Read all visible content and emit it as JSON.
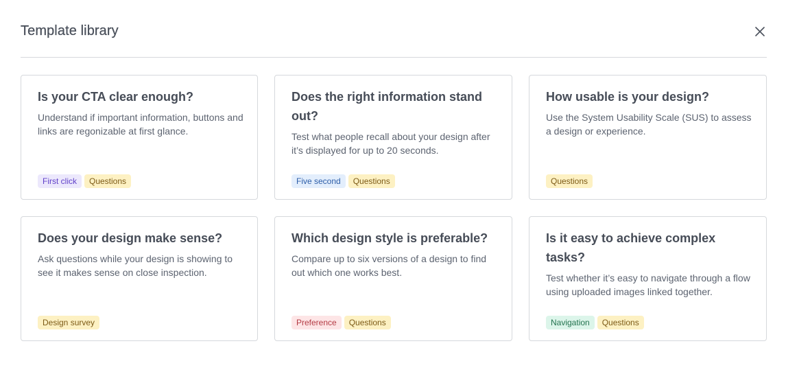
{
  "header": {
    "title": "Template library",
    "close_icon": "close-icon"
  },
  "tag_styles": {
    "First click": {
      "bg": "#ece8fc",
      "fg": "#6141c9"
    },
    "Questions": {
      "bg": "#fdf1c3",
      "fg": "#7c5a16"
    },
    "Five second": {
      "bg": "#e3eefc",
      "fg": "#2c5da8"
    },
    "Design survey": {
      "bg": "#fdf1c3",
      "fg": "#7c5a16"
    },
    "Preference": {
      "bg": "#fde5e6",
      "fg": "#b43b44"
    },
    "Navigation": {
      "bg": "#dcf5ea",
      "fg": "#23734f"
    }
  },
  "templates": [
    {
      "title": "Is your CTA clear enough?",
      "description": "Understand if important information, buttons and links are regonizable at first glance.",
      "tags": [
        "First click",
        "Questions"
      ]
    },
    {
      "title": "Does the right information stand out?",
      "description": "Test what people recall about your design after it’s displayed for up to 20 seconds.",
      "tags": [
        "Five second",
        "Questions"
      ]
    },
    {
      "title": "How usable is your design?",
      "description": "Use the System Usability Scale (SUS) to assess a design or experience.",
      "tags": [
        "Questions"
      ]
    },
    {
      "title": "Does your design make sense?",
      "description": "Ask questions while your design is showing to see it makes sense on close inspection.",
      "tags": [
        "Design survey"
      ]
    },
    {
      "title": "Which design style is preferable?",
      "description": "Compare up to six versions of a design to find out which one works best.",
      "tags": [
        "Preference",
        "Questions"
      ]
    },
    {
      "title": "Is it easy to achieve complex tasks?",
      "description": "Test whether it’s easy to navigate through a flow using uploaded images linked together.",
      "tags": [
        "Navigation",
        "Questions"
      ]
    }
  ]
}
